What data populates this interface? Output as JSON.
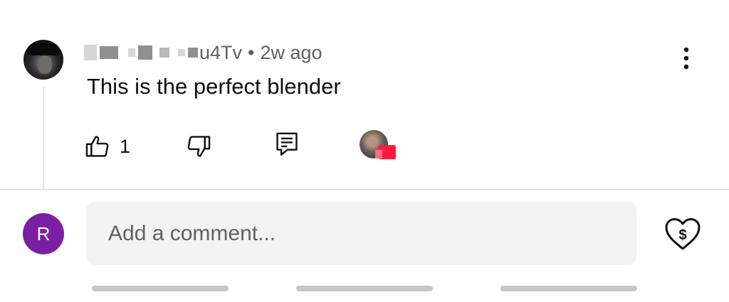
{
  "comment": {
    "author_suffix": "u4Tv",
    "separator": "•",
    "time": "2w ago",
    "text": "This is the perfect blender",
    "likes": "1",
    "author_avatar_icon": "user-avatar-photo",
    "creator_heart_icon": "creator-heart-avatar"
  },
  "icons": {
    "menu": "more-vertical-icon",
    "like": "thumb-up-icon",
    "dislike": "thumb-down-icon",
    "reply": "reply-comment-icon",
    "thanks": "heart-dollar-icon"
  },
  "composer": {
    "avatar_initial": "R",
    "placeholder": "Add a comment...",
    "avatar_color": "#7b1fa2",
    "input_bg": "#f2f2f2"
  }
}
